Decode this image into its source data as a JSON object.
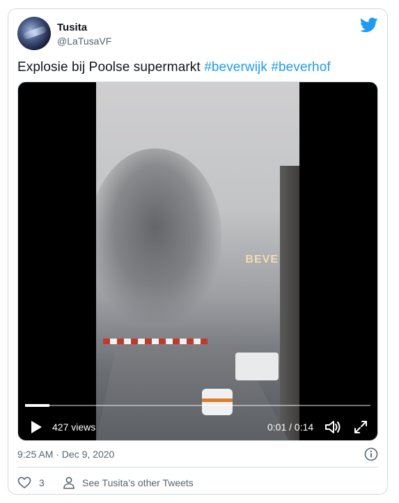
{
  "author": {
    "display_name": "Tusita",
    "handle": "@LaTusaVF"
  },
  "tweet": {
    "text": "Explosie bij Poolse supermarkt",
    "hashtags": [
      "#beverwijk",
      "#beverhof"
    ]
  },
  "video": {
    "scene_sign": "BEVE",
    "views": "427 views",
    "time": "0:01 / 0:14",
    "progress": 0.07
  },
  "meta": {
    "timestamp": "9:25 AM · Dec 9, 2020"
  },
  "actions": {
    "likes": "3",
    "see_others": "See Tusita’s other Tweets"
  },
  "colors": {
    "accent": "#1d9bf0",
    "secondary_text": "#536471",
    "border": "#cfd9de"
  },
  "icons": [
    "twitter-bird-icon",
    "play-icon",
    "volume-icon",
    "fullscreen-icon",
    "info-icon",
    "heart-icon",
    "person-icon"
  ]
}
